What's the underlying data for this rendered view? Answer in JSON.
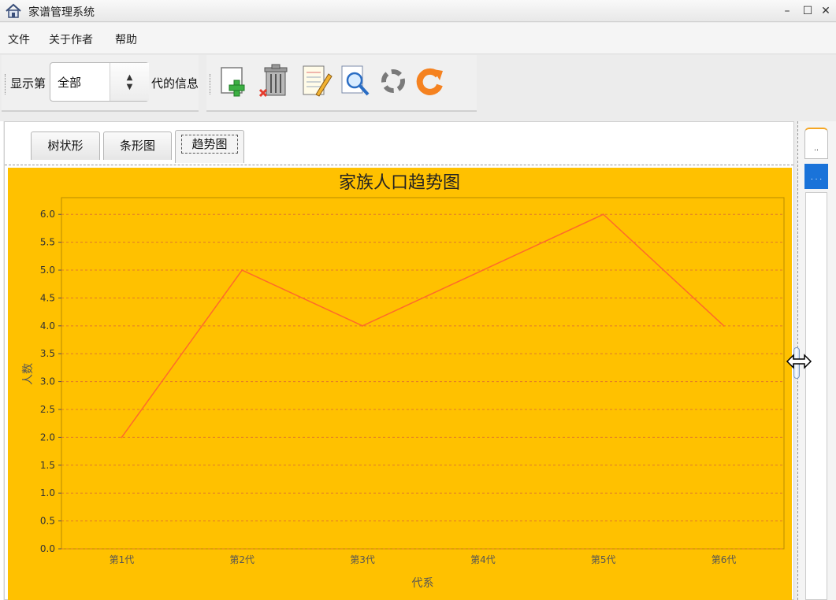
{
  "window": {
    "title": "家谱管理系统",
    "minimize": "–",
    "maximize": "☐",
    "close": "✕"
  },
  "menu": {
    "items": [
      "文件",
      "关于作者",
      "帮助"
    ]
  },
  "toolbar": {
    "show_label": "显示第",
    "generation_select": {
      "value": "全部",
      "arrows": "▲\n▼"
    },
    "info_label": "代的信息",
    "buttons": [
      {
        "name": "add-member",
        "icon": "add-page-icon"
      },
      {
        "name": "delete-member",
        "icon": "trash-icon"
      },
      {
        "name": "edit-member",
        "icon": "edit-notepad-icon"
      },
      {
        "name": "search-member",
        "icon": "magnifier-icon"
      },
      {
        "name": "recycle",
        "icon": "recycle-icon"
      },
      {
        "name": "refresh",
        "icon": "refresh-icon"
      }
    ]
  },
  "tabs": [
    {
      "label": "树状形",
      "active": false
    },
    {
      "label": "条形图",
      "active": false
    },
    {
      "label": "趋势图",
      "active": true
    }
  ],
  "side_panel": {
    "btn1": "..",
    "btn2": ". . ."
  },
  "colors": {
    "chart_background": "#ffc100",
    "line": "#ff6a2a",
    "gridline": "#e07a2a"
  },
  "chart_data": {
    "type": "line",
    "title": "家族人口趋势图",
    "xlabel": "代系",
    "ylabel": "人数",
    "categories": [
      "第1代",
      "第2代",
      "第3代",
      "第4代",
      "第5代",
      "第6代"
    ],
    "series": [
      {
        "values": [
          2.0,
          5.0,
          4.0,
          5.0,
          6.0,
          4.0
        ]
      }
    ],
    "ylim": [
      0,
      6.3
    ],
    "yticks": [
      "0.0",
      "0.5",
      "1.0",
      "1.5",
      "2.0",
      "2.5",
      "3.0",
      "3.5",
      "4.0",
      "4.5",
      "5.0",
      "5.5",
      "6.0"
    ],
    "grid": true,
    "legend": "none"
  }
}
